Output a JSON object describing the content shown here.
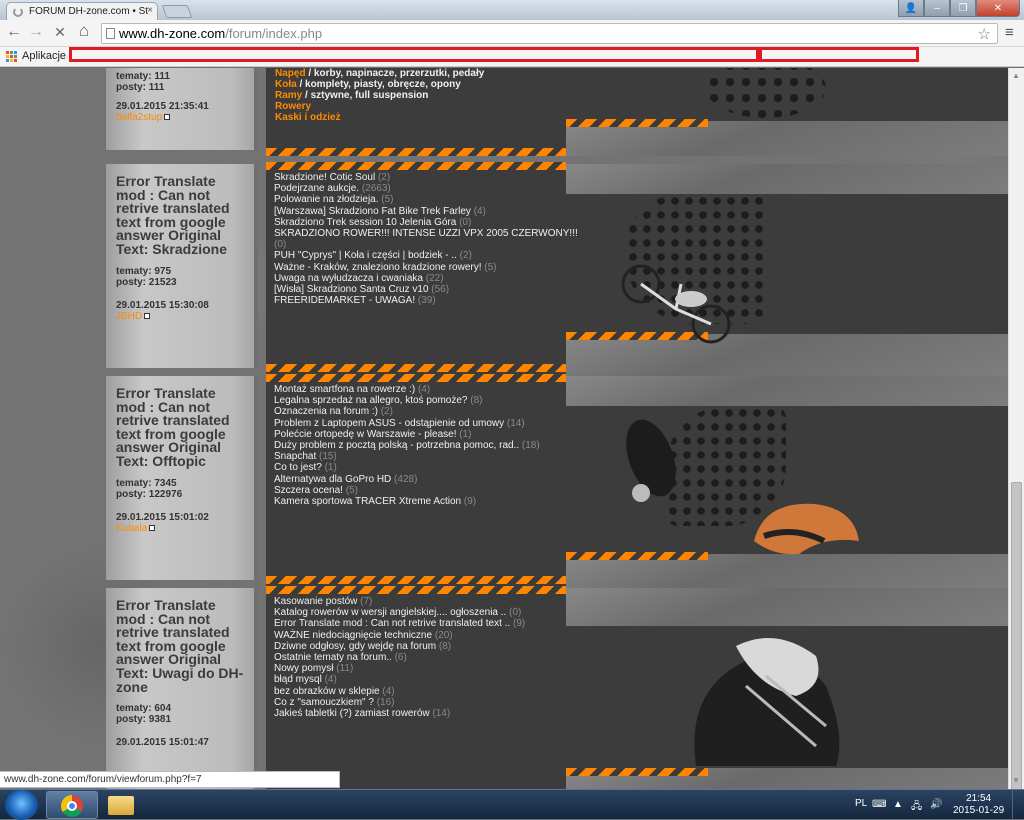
{
  "browser": {
    "tab_title": "FORUM DH-zone.com • St",
    "tab_close": "×",
    "url_host": "www.dh-zone.com",
    "url_path": "/forum/index.php",
    "bookmarks_apps_label": "Aplikacje",
    "status_url": "www.dh-zone.com/forum/viewforum.php?f=7",
    "nav": {
      "back": "←",
      "forward": "→",
      "stop": "✕",
      "home": "⌂",
      "star": "☆",
      "menu": "≡"
    },
    "window_buttons": {
      "user": "👤",
      "minimize": "–",
      "maximize": "❐",
      "close": "✕"
    }
  },
  "forum": {
    "rows": [
      {
        "last_post_title": "",
        "topics_label": "tematy:",
        "topics": "111",
        "posts_label": "posty:",
        "posts": "111",
        "date": "29.01.2015 21:35:41",
        "user": "balfa2stup",
        "categories": [
          {
            "name": "Napęd",
            "rest": " / korby, napinacze, przerzutki, pedały"
          },
          {
            "name": "Koła",
            "rest": " / komplety, piasty, obręcze, opony"
          },
          {
            "name": "Ramy",
            "rest": " / sztywne, full suspension"
          },
          {
            "name": "Rowery",
            "rest": ""
          },
          {
            "name": "Kaski i odzież",
            "rest": ""
          }
        ]
      },
      {
        "last_post_title": "Error Translate mod : Can not retrive translated text from google answer Original Text: Skradzione",
        "topics_label": "tematy:",
        "topics": "975",
        "posts_label": "posty:",
        "posts": "21523",
        "date": "29.01.2015 15:30:08",
        "user": "JBHD",
        "items": [
          {
            "t": "Skradzione! Cotic Soul",
            "c": " (2)"
          },
          {
            "t": "Podejrzane aukcje.",
            "c": " (2663)"
          },
          {
            "t": "Polowanie na złodzieja.",
            "c": " (5)"
          },
          {
            "t": "[Warszawa] Skradziono Fat Bike Trek Farley",
            "c": " (4)"
          },
          {
            "t": "Skradziono Trek session 10 Jelenia Góra",
            "c": " (0)"
          },
          {
            "t": "SKRADZIONO ROWER!!! INTENSE UZZI VPX 2005 CZERWONY!!!",
            "c": ""
          },
          {
            "t": "",
            "c": "(0)"
          },
          {
            "t": "PUH \"Cyprys\" | Koła i części | bodziek - ..",
            "c": " (2)"
          },
          {
            "t": "Ważne - Kraków, znaleziono kradzione rowery!",
            "c": " (5)"
          },
          {
            "t": "Uwaga na wyłudzacza i cwaniaka",
            "c": " (22)"
          },
          {
            "t": "[Wisła] Skradziono Santa Cruz v10",
            "c": " (56)"
          },
          {
            "t": "FREERIDEMARKET - UWAGA!",
            "c": " (39)"
          }
        ]
      },
      {
        "last_post_title": "Error Translate mod : Can not retrive translated text from google answer Original Text: Offtopic",
        "topics_label": "tematy:",
        "topics": "7345",
        "posts_label": "posty:",
        "posts": "122976",
        "date": "29.01.2015 15:01:02",
        "user": "Kubala",
        "items": [
          {
            "t": "Montaż smartfona na rowerze :)",
            "c": " (4)"
          },
          {
            "t": "Legalna sprzedaż na allegro, ktoś pomoże?",
            "c": " (8)"
          },
          {
            "t": "Oznaczenia na forum :)",
            "c": " (2)"
          },
          {
            "t": "Problem z Laptopem ASUS - odstąpienie od umowy",
            "c": " (14)"
          },
          {
            "t": "Polećcie ortopedę w Warszawie - please!",
            "c": " (1)"
          },
          {
            "t": "Duży problem z pocztą polską - potrzebna pomoc, rad..",
            "c": " (18)"
          },
          {
            "t": "Snapchat",
            "c": " (15)"
          },
          {
            "t": "Co to jest?",
            "c": " (1)"
          },
          {
            "t": "Alternatywa dla GoPro HD",
            "c": " (428)"
          },
          {
            "t": "Szczera ocena!",
            "c": " (5)"
          },
          {
            "t": "Kamera sportowa TRACER Xtreme Action",
            "c": " (9)"
          }
        ]
      },
      {
        "last_post_title": "Error Translate mod : Can not retrive translated text from google answer Original Text: Uwagi do DH-zone",
        "topics_label": "tematy:",
        "topics": "604",
        "posts_label": "posty:",
        "posts": "9381",
        "date": "29.01.2015 15:01:47",
        "user": "",
        "items": [
          {
            "t": "Kasowanie postów",
            "c": " (7)"
          },
          {
            "t": "Katalog rowerów w wersji angielskiej.... ogłoszenia ..",
            "c": " (0)"
          },
          {
            "t": "Error Translate mod : Can not retrive translated text ..",
            "c": " (9)"
          },
          {
            "t": "WAŻNE niedociągnięcie techniczne",
            "c": " (20)"
          },
          {
            "t": "Dziwne odgłosy, gdy wejdę na forum",
            "c": " (8)"
          },
          {
            "t": "Ostatnie tematy na forum..",
            "c": " (6)"
          },
          {
            "t": "Nowy pomysł",
            "c": " (11)"
          },
          {
            "t": "błąd mysql",
            "c": " (4)"
          },
          {
            "t": "bez obrazków w sklepie",
            "c": " (4)"
          },
          {
            "t": "Co z \"samouczkiem\" ?",
            "c": " (16)"
          },
          {
            "t": "Jakieś tabletki (?) zamiast rowerów",
            "c": " (14)"
          }
        ]
      }
    ]
  },
  "taskbar": {
    "lang": "PL",
    "time": "21:54",
    "date": "2015-01-29"
  },
  "colors": {
    "accent": "#ff8400",
    "panel": "#3c3c3c",
    "user": "#ff8a00"
  }
}
